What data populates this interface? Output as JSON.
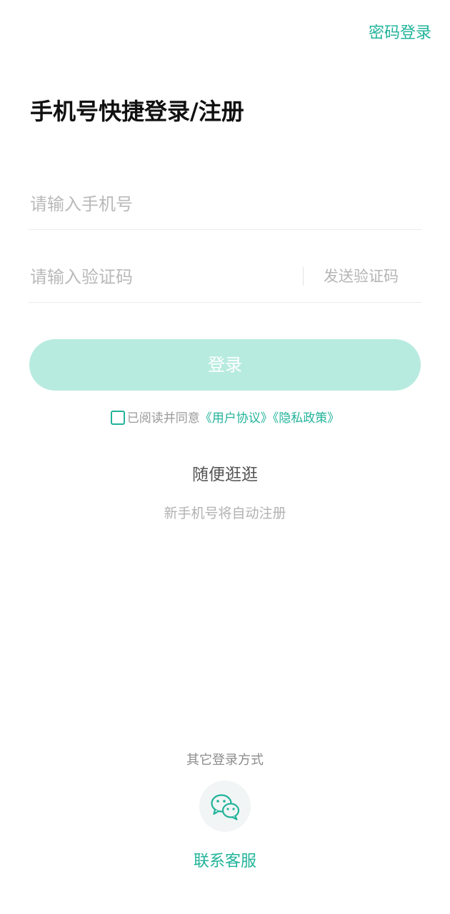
{
  "header": {
    "password_login_link": "密码登录"
  },
  "title": "手机号快捷登录/注册",
  "form": {
    "phone": {
      "value": "",
      "placeholder": "请输入手机号"
    },
    "code": {
      "value": "",
      "placeholder": "请输入验证码"
    },
    "send_code_label": "发送验证码",
    "login_label": "登录"
  },
  "agreement": {
    "checked": false,
    "prefix": "已阅读并同意",
    "user_agreement": "《用户协议》",
    "privacy_policy": "《隐私政策》"
  },
  "browse_label": "随便逛逛",
  "auto_register_note": "新手机号将自动注册",
  "other_login": {
    "label": "其它登录方式",
    "methods": [
      {
        "icon": "wechat-icon"
      }
    ]
  },
  "service_link": "联系客服",
  "colors": {
    "accent": "#22b39a",
    "button_disabled": "#b8ebe0",
    "placeholder": "#b9b9b9"
  }
}
